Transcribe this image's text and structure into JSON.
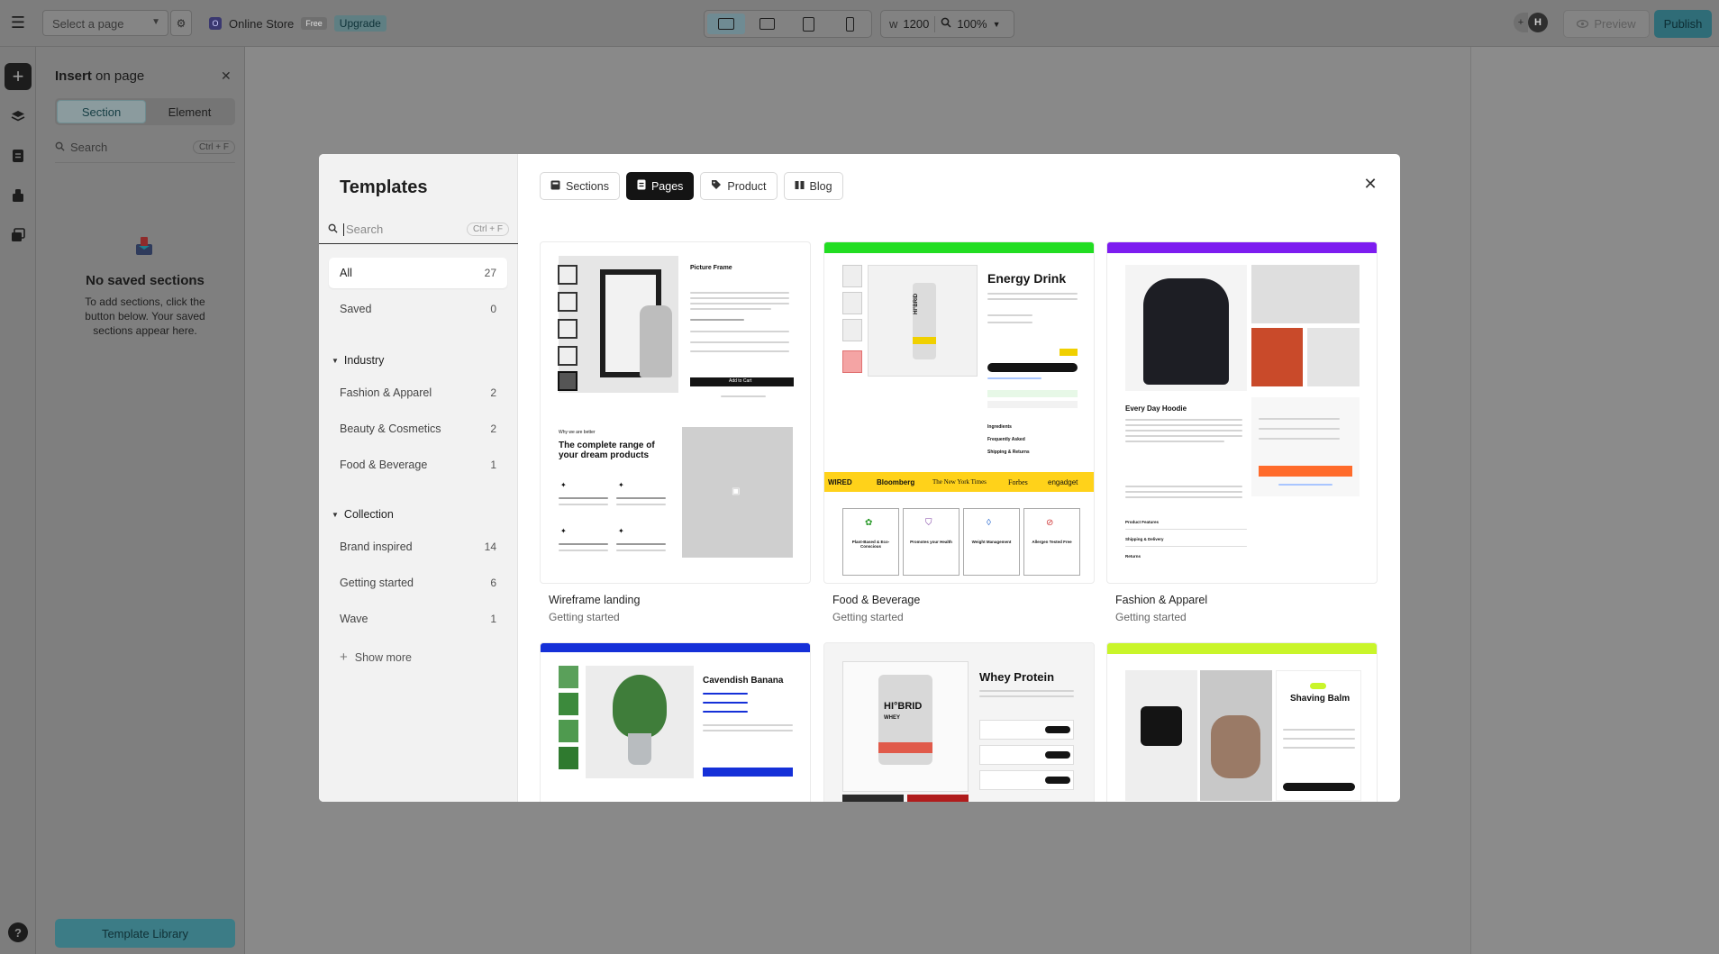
{
  "topbar": {
    "page_select_placeholder": "Select a page",
    "store_icon_letter": "O",
    "store_name": "Online Store",
    "plan_badge": "Free",
    "upgrade_label": "Upgrade",
    "width_label": "w",
    "width_value": "1200",
    "zoom_value": "100%",
    "avatar_initial": "H",
    "preview_label": "Preview",
    "publish_label": "Publish"
  },
  "insert_panel": {
    "title_bold": "Insert",
    "title_rest": "on page",
    "tabs": [
      "Section",
      "Element"
    ],
    "search_placeholder": "Search",
    "search_shortcut": "Ctrl + F",
    "empty_title": "No saved sections",
    "empty_text": "To add sections, click the button below. Your saved sections appear here.",
    "library_button": "Template Library"
  },
  "modal": {
    "title": "Templates",
    "search_placeholder": "Search",
    "search_shortcut": "Ctrl + F",
    "tabs": [
      {
        "label": "Sections",
        "icon": "sections-icon"
      },
      {
        "label": "Pages",
        "icon": "pages-icon"
      },
      {
        "label": "Product",
        "icon": "tag-icon"
      },
      {
        "label": "Blog",
        "icon": "blog-icon"
      }
    ],
    "categories": [
      {
        "label": "All",
        "count": "27"
      },
      {
        "label": "Saved",
        "count": "0"
      }
    ],
    "industry": {
      "title": "Industry",
      "items": [
        {
          "label": "Fashion & Apparel",
          "count": "2"
        },
        {
          "label": "Beauty & Cosmetics",
          "count": "2"
        },
        {
          "label": "Food & Beverage",
          "count": "1"
        }
      ]
    },
    "collection": {
      "title": "Collection",
      "items": [
        {
          "label": "Brand inspired",
          "count": "14"
        },
        {
          "label": "Getting started",
          "count": "6"
        },
        {
          "label": "Wave",
          "count": "1"
        }
      ]
    },
    "show_more": "Show more",
    "templates": [
      {
        "name": "Wireframe landing",
        "collection": "Getting started"
      },
      {
        "name": "Food & Beverage",
        "collection": "Getting started"
      },
      {
        "name": "Fashion & Apparel",
        "collection": "Getting started"
      }
    ],
    "preview_text": {
      "picture_frame": "Picture Frame",
      "range_heading": "The complete range of your dream products",
      "why_label": "Why we are better",
      "add_to_cart": "Add to Cart",
      "energy_drink": "Energy Drink",
      "brand": "HI°BRID",
      "press": [
        "WIRED",
        "Bloomberg",
        "The New York Times",
        "Forbes",
        "engadget"
      ],
      "every_day_hoodie": "Every Day Hoodie",
      "cavendish_banana": "Cavendish Banana",
      "whey_protein": "Whey Protein",
      "whey": "WHEY",
      "shaving_balm": "Shaving Balm",
      "energy_features": [
        "Plant-Based & Eco-Conscious",
        "Promotes your Health",
        "Weight Management",
        "Allergen Tested Free"
      ],
      "energy_accordion": [
        "Ingredients",
        "Frequently Asked",
        "Shipping & Returns"
      ],
      "hoodie_accordion": [
        "Product Features",
        "Shipping & Delivery",
        "Returns"
      ]
    }
  },
  "colors": {
    "accent": "#0e8a9c",
    "energy_green": "#22dd22",
    "press_yellow": "#ffd21a",
    "hoodie_purple": "#7d1cf0",
    "banana_blue": "#1530d8",
    "shave_lime": "#c9f52a"
  }
}
